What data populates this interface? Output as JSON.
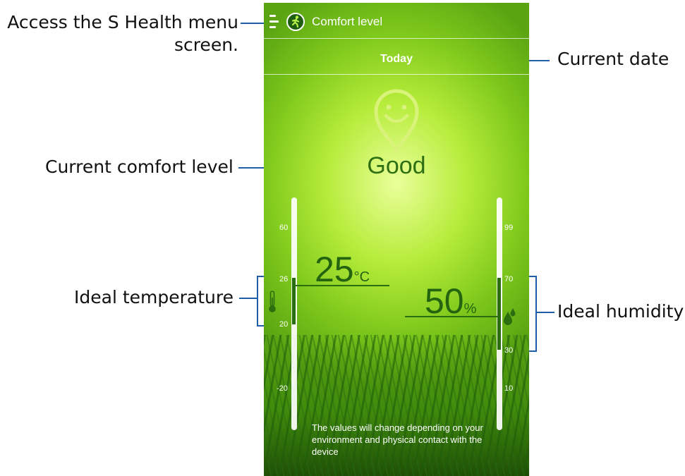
{
  "annotations": {
    "menu": "Access the S Health menu screen.",
    "date": "Current date",
    "comfort": "Current comfort level",
    "temperature": "Ideal temperature",
    "humidity": "Ideal humidity"
  },
  "actionbar": {
    "title": "Comfort level",
    "menu_icon": "menu-icon",
    "app_icon": "walker-icon"
  },
  "date_label": "Today",
  "comfort_level": "Good",
  "temperature": {
    "value": "25",
    "unit": "°C",
    "scale_top": "60",
    "ideal_max": "26",
    "ideal_min": "20",
    "scale_bottom": "-20",
    "icon": "thermometer-icon"
  },
  "humidity": {
    "value": "50",
    "unit": "%",
    "scale_top": "99",
    "ideal_max": "70",
    "ideal_min": "30",
    "scale_bottom": "10",
    "icon": "water-drop-icon"
  },
  "notice": "The values will change depending on your environment and physical contact with the device",
  "colors": {
    "accent_green": "#2a6e10",
    "annotation_line": "#1f5fa8"
  }
}
